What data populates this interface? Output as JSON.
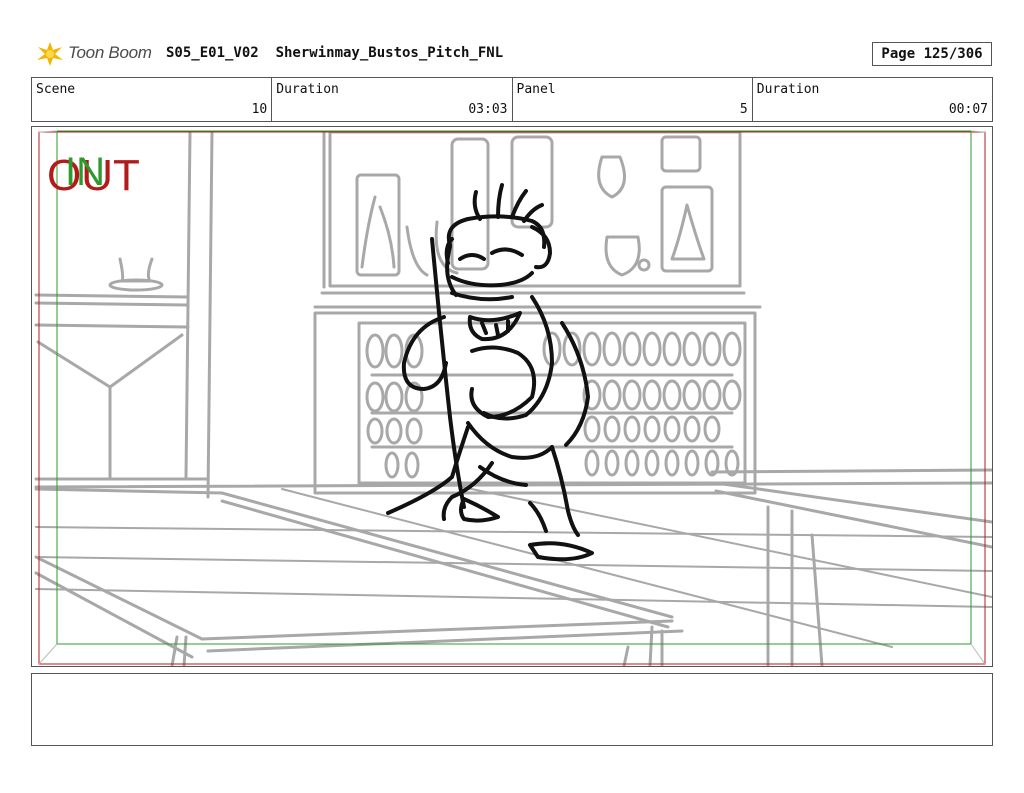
{
  "header": {
    "brand": "Toon Boom",
    "project_title": "S05_E01_V02  Sherwinmay_Bustos_Pitch_FNL",
    "page": "Page 125/306"
  },
  "info": {
    "scene_label": "Scene",
    "scene_value": "10",
    "scene_duration_label": "Duration",
    "scene_duration_value": "03:03",
    "panel_label": "Panel",
    "panel_value": "5",
    "panel_duration_label": "Duration",
    "panel_duration_value": "00:07"
  },
  "panel": {
    "out_label": "OUT",
    "in_label": "IN"
  },
  "colors": {
    "out_red": "#b31b1b",
    "in_green": "#2c9a2c",
    "sketch_gray": "#a8a8a8",
    "ink": "#111111"
  },
  "notes": {
    "text": ""
  }
}
